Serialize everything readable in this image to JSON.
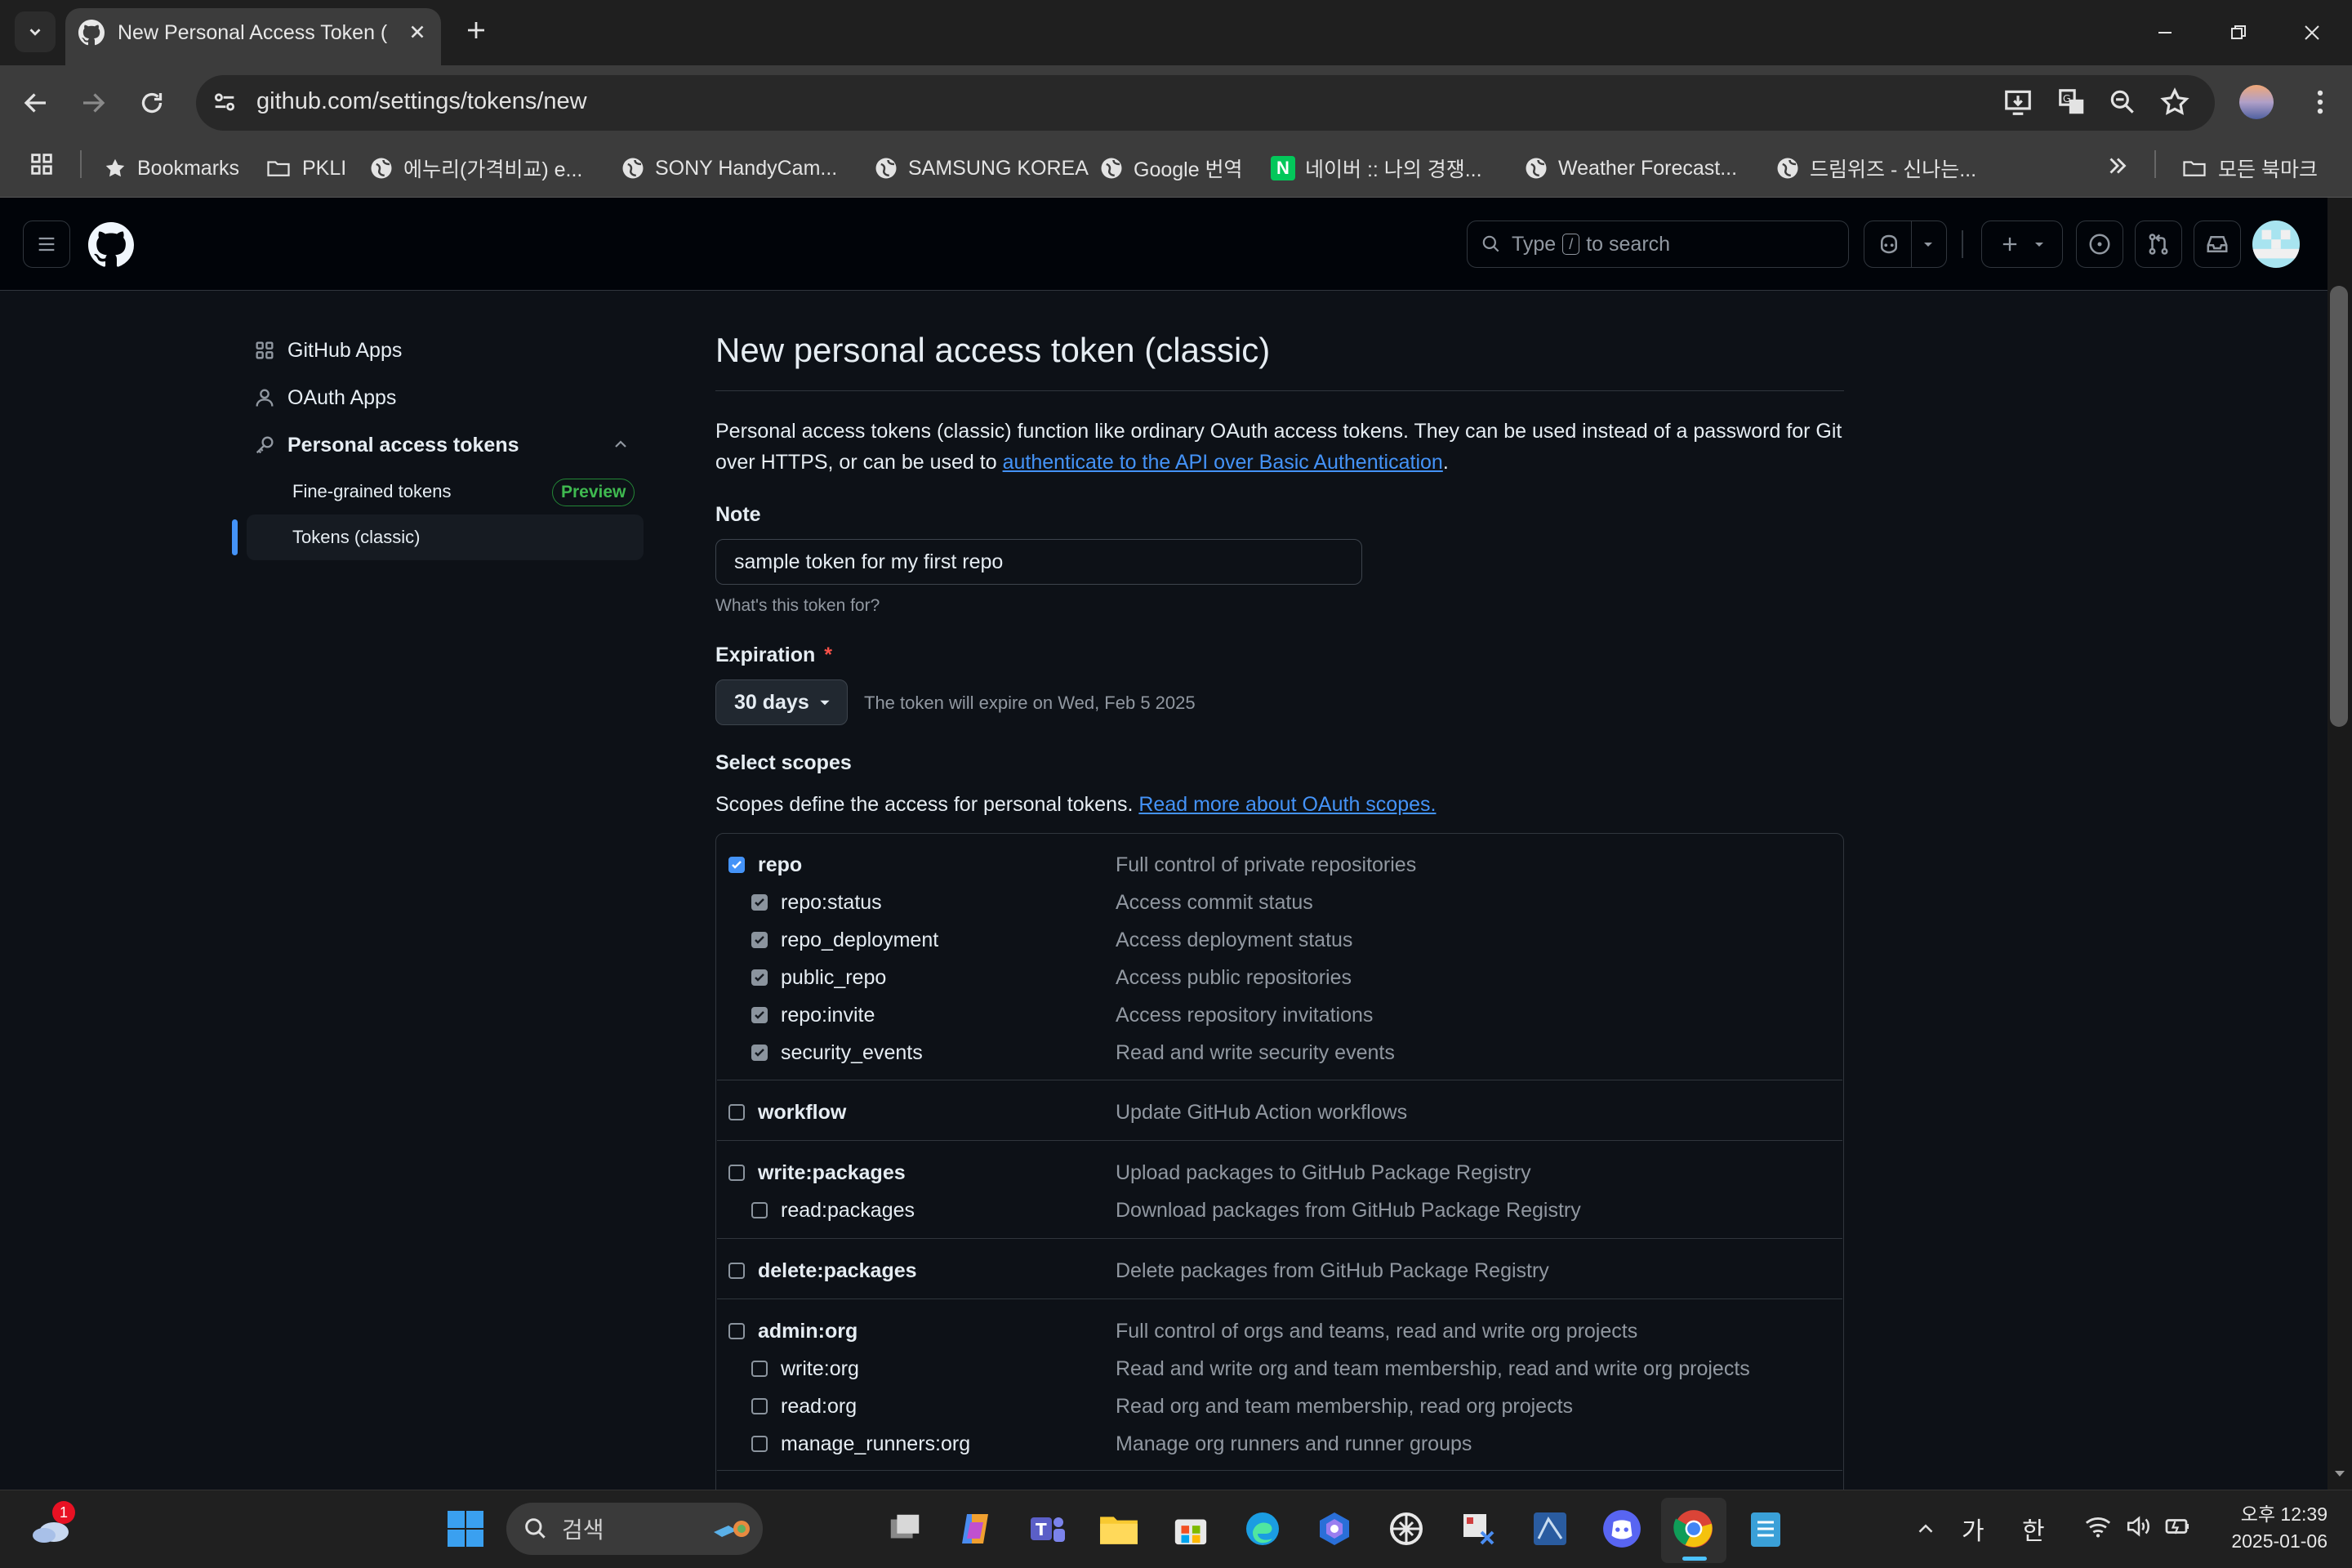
{
  "browser": {
    "tab_title": "New Personal Access Token (C",
    "url": "github.com/settings/tokens/new",
    "bookmarks": [
      {
        "label": "Bookmarks",
        "icon": "star-icon"
      },
      {
        "label": "PKLI",
        "icon": "folder-icon"
      },
      {
        "label": "에누리(가격비교) e...",
        "icon": "globe-icon"
      },
      {
        "label": "SONY HandyCam...",
        "icon": "globe-icon"
      },
      {
        "label": "SAMSUNG KOREA",
        "icon": "globe-icon"
      },
      {
        "label": "Google 번역",
        "icon": "globe-icon"
      },
      {
        "label": "네이버 :: 나의 경쟁...",
        "icon": "naver-icon"
      },
      {
        "label": "Weather Forecast...",
        "icon": "globe-icon"
      },
      {
        "label": "드림위즈 - 신나는...",
        "icon": "globe-icon"
      }
    ],
    "all_bookmarks": "모든 북마크",
    "naver_letter": "N"
  },
  "github": {
    "search_prefix": "Type",
    "search_key": "/",
    "search_suffix": "to search"
  },
  "sidebar": {
    "items": [
      {
        "label": "GitHub Apps"
      },
      {
        "label": "OAuth Apps"
      },
      {
        "label": "Personal access tokens"
      }
    ],
    "sub_items": [
      {
        "label": "Fine-grained tokens",
        "badge": "Preview"
      },
      {
        "label": "Tokens (classic)"
      }
    ]
  },
  "main": {
    "title": "New personal access token (classic)",
    "intro_line1": "Personal access tokens (classic) function like ordinary OAuth access tokens. They can be used instead of a password for Git",
    "intro_line2_prefix": "over HTTPS, or can be used to ",
    "intro_link": "authenticate to the API over Basic Authentication",
    "intro_line2_suffix": ".",
    "note_label": "Note",
    "note_value": "sample token for my first repo",
    "note_hint": "What's this token for?",
    "expiration_label": "Expiration",
    "expiration_required": "*",
    "expiration_value": "30 days",
    "expiration_hint": "The token will expire on Wed, Feb 5 2025",
    "scopes_label": "Select scopes",
    "scopes_desc": "Scopes define the access for personal tokens. ",
    "scopes_link": "Read more about OAuth scopes."
  },
  "scopes": [
    {
      "name": "repo",
      "desc": "Full control of private repositories",
      "checked": true,
      "level": 0
    },
    {
      "name": "repo:status",
      "desc": "Access commit status",
      "checked": true,
      "level": 1
    },
    {
      "name": "repo_deployment",
      "desc": "Access deployment status",
      "checked": true,
      "level": 1
    },
    {
      "name": "public_repo",
      "desc": "Access public repositories",
      "checked": true,
      "level": 1
    },
    {
      "name": "repo:invite",
      "desc": "Access repository invitations",
      "checked": true,
      "level": 1
    },
    {
      "name": "security_events",
      "desc": "Read and write security events",
      "checked": true,
      "level": 1
    },
    {
      "name": "workflow",
      "desc": "Update GitHub Action workflows",
      "checked": false,
      "level": 0
    },
    {
      "name": "write:packages",
      "desc": "Upload packages to GitHub Package Registry",
      "checked": false,
      "level": 0
    },
    {
      "name": "read:packages",
      "desc": "Download packages from GitHub Package Registry",
      "checked": false,
      "level": 1
    },
    {
      "name": "delete:packages",
      "desc": "Delete packages from GitHub Package Registry",
      "checked": false,
      "level": 0
    },
    {
      "name": "admin:org",
      "desc": "Full control of orgs and teams, read and write org projects",
      "checked": false,
      "level": 0
    },
    {
      "name": "write:org",
      "desc": "Read and write org and team membership, read and write org projects",
      "checked": false,
      "level": 1
    },
    {
      "name": "read:org",
      "desc": "Read org and team membership, read org projects",
      "checked": false,
      "level": 1
    },
    {
      "name": "manage_runners:org",
      "desc": "Manage org runners and runner groups",
      "checked": false,
      "level": 1
    }
  ],
  "taskbar": {
    "search_placeholder": "검색",
    "weather_badge": "1",
    "ime_1": "가",
    "ime_2": "한",
    "time": "오후 12:39",
    "date": "2025-01-06"
  },
  "colors": {
    "accent": "#4493f8",
    "success_badge": "#3fb950",
    "danger": "#f85149"
  }
}
